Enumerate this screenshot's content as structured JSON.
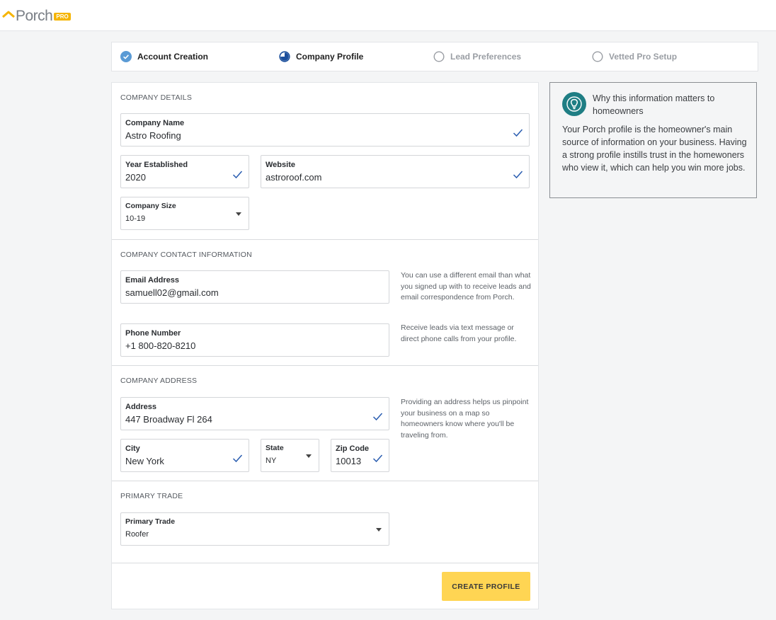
{
  "brand": {
    "name": "Porch",
    "badge": "PRO",
    "accent": "#f5b400"
  },
  "steps": [
    {
      "label": "Account Creation",
      "state": "done"
    },
    {
      "label": "Company Profile",
      "state": "active"
    },
    {
      "label": "Lead Preferences",
      "state": "pending"
    },
    {
      "label": "Vetted Pro Setup",
      "state": "pending"
    }
  ],
  "company_details": {
    "title": "COMPANY DETAILS",
    "company_name": {
      "label": "Company Name",
      "value": "Astro Roofing"
    },
    "year_established": {
      "label": "Year Established",
      "value": "2020"
    },
    "website": {
      "label": "Website",
      "value": "astroroof.com"
    },
    "company_size": {
      "label": "Company Size",
      "value": "10-19"
    }
  },
  "contact": {
    "title": "COMPANY CONTACT INFORMATION",
    "email": {
      "label": "Email Address",
      "value": "samuell02@gmail.com",
      "hint": "You can use a different email than what you signed up with to receive leads and email correspondence from Porch."
    },
    "phone": {
      "label": "Phone Number",
      "value": "+1 800-820-8210",
      "hint": "Receive leads via text message or direct phone calls from your profile."
    }
  },
  "address": {
    "title": "COMPANY ADDRESS",
    "street": {
      "label": "Address",
      "value": "447 Broadway Fl 264"
    },
    "city": {
      "label": "City",
      "value": "New York"
    },
    "state": {
      "label": "State",
      "value": "NY"
    },
    "zip": {
      "label": "Zip Code",
      "value": "10013"
    },
    "hint": "Providing an address helps us pinpoint your business on a map so homeowners know where you'll be traveling from."
  },
  "trade": {
    "title": "PRIMARY TRADE",
    "primary_trade": {
      "label": "Primary Trade",
      "value": "Roofer"
    }
  },
  "submit_label": "CREATE PROFILE",
  "info": {
    "title": "Why this information matters to homeowners",
    "body": "Your Porch profile is the homeowner's main source of information on your business. Having a strong profile instills trust in the homewoners who view it, which can help you win more jobs."
  },
  "colors": {
    "check": "#2a5db0",
    "button": "#ffd553",
    "info_icon_bg": "#1f7e84",
    "step_done": "#5b9bd5"
  }
}
